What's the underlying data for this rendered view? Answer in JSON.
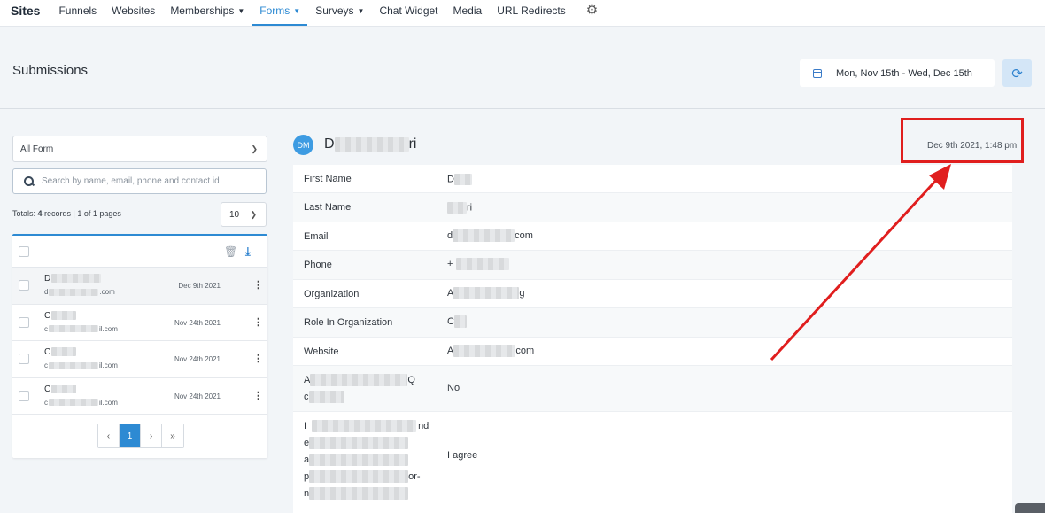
{
  "nav": {
    "title": "Sites",
    "items": [
      {
        "label": "Funnels",
        "caret": false
      },
      {
        "label": "Websites",
        "caret": false
      },
      {
        "label": "Memberships",
        "caret": true
      },
      {
        "label": "Forms",
        "caret": true,
        "active": true
      },
      {
        "label": "Surveys",
        "caret": true
      },
      {
        "label": "Chat Widget",
        "caret": false
      },
      {
        "label": "Media",
        "caret": false
      },
      {
        "label": "URL Redirects",
        "caret": false
      }
    ],
    "settings_icon": "gear-icon"
  },
  "header": {
    "title": "Submissions",
    "date_range": "Mon, Nov 15th - Wed, Dec 15th"
  },
  "filters": {
    "form_select": "All Form",
    "search_placeholder": "Search by name, email, phone and contact id",
    "totals_prefix": "Totals: ",
    "totals_count": "4",
    "totals_suffix": " records | 1 of 1 pages",
    "per_page": "10"
  },
  "submissions": [
    {
      "name": "D",
      "email_start": "d",
      "email_end": ".com",
      "date": "Dec 9th 2021",
      "selected": true
    },
    {
      "name": "C",
      "email_start": "c",
      "email_end": "il.com",
      "date": "Nov 24th 2021",
      "selected": false
    },
    {
      "name": "C",
      "email_start": "c",
      "email_end": "il.com",
      "date": "Nov 24th 2021",
      "selected": false
    },
    {
      "name": "C",
      "email_start": "c",
      "email_end": "il.com",
      "date": "Nov 24th 2021",
      "selected": false
    }
  ],
  "pagination": {
    "prev": "‹",
    "current": "1",
    "next": "›",
    "last": "»"
  },
  "detail": {
    "avatar": "DM",
    "name_start": "D",
    "name_end": "ri",
    "submitted_at": "Dec 9th 2021, 1:48 pm",
    "fields": [
      {
        "label": "First Name",
        "value": "D"
      },
      {
        "label": "Last Name",
        "value": "ri"
      },
      {
        "label": "Email",
        "value": "d",
        "value_end": "com"
      },
      {
        "label": "Phone",
        "value": "+"
      },
      {
        "label": "Organization",
        "value": "A",
        "value_end": "g"
      },
      {
        "label": "Role In Organization",
        "value": "C"
      },
      {
        "label": "Website",
        "value": "A",
        "value_end": "com"
      },
      {
        "label": "A",
        "label_end": "Q",
        "label_line2": "c",
        "value": "No"
      },
      {
        "label": "I",
        "label_end": "nd",
        "label_lines": [
          "e",
          "a",
          "p",
          "n"
        ],
        "label_lines_end": [
          "",
          "",
          "or-",
          ""
        ],
        "value": "I agree"
      }
    ]
  },
  "colors": {
    "accent": "#2d8ad3",
    "highlight": "#e01e1e"
  }
}
